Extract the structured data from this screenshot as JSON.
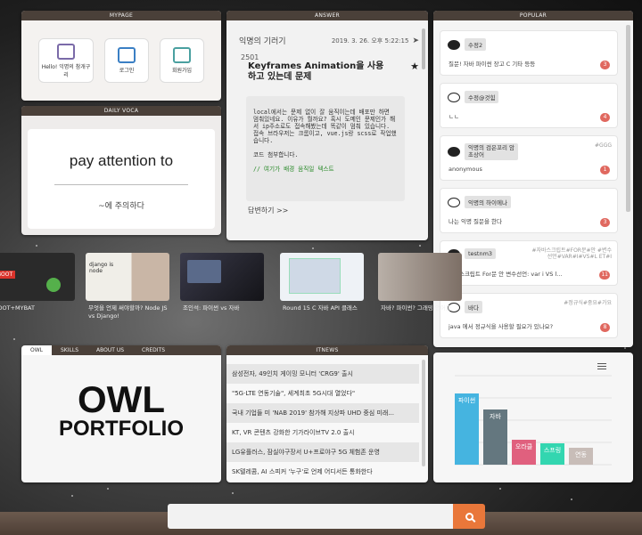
{
  "mypage": {
    "title": "MYPAGE",
    "buttons": [
      {
        "label": "Hello! 익명의 참개구리",
        "icon": "user-profile-icon"
      },
      {
        "label": "로그인",
        "icon": "login-icon"
      },
      {
        "label": "회원가입",
        "icon": "signup-icon"
      }
    ]
  },
  "voca": {
    "title": "DAILY VOCA",
    "word": "pay attention to",
    "meaning": "~에 주의하다"
  },
  "answer": {
    "title": "ANSWER",
    "author": "익명의 기러기",
    "date": "2019. 3. 26. 오후 5:22:15",
    "number": "2501",
    "question_title": "Keyframes Animation을 사용하고 있는데 문제",
    "body_p1": "local에서는 문제 없이 잘 움직이는데 배포만 하면 멈춰있네요. 이유가 뭘까요? 혹시 도메인 문제인가 해서 ip주소로도 접속해봤는데 똑같이 멈춰 있습니다.",
    "body_p2": "접속 브라우저는 크롬이고, vue.js랑 scss로 작업했습니다.",
    "body_p3": "코드 첨부합니다.",
    "code_comment": "// 여기가 배경 움직일 텍스트",
    "reply_label": "답변하기 >>",
    "icons": {
      "share": "share-icon",
      "star": "star-icon"
    }
  },
  "popular": {
    "title": "POPULAR",
    "items": [
      {
        "name": "수정2",
        "tags": "",
        "text": "질문! 자바 파이썬 장고 C 기타 등등",
        "count": "3",
        "filled": true
      },
      {
        "name": "수정@것힘",
        "tags": "",
        "text": "ㄴㄴ",
        "count": "4",
        "filled": false
      },
      {
        "name": "익명의 검은꼬리 암초상어",
        "tags": "#GGG",
        "text": "anonymous",
        "count": "1",
        "filled": true
      },
      {
        "name": "익명의 하이에나",
        "tags": "",
        "text": "나는 익명 질문을 한다",
        "count": "3",
        "filled": false
      },
      {
        "name": "testnm3",
        "tags": "#자바스크립트#FOR문#안 #변수선언#VAR#I#VS#L ET#I",
        "text": "자바스크립트 For문 안 변수선언: var i VS l...",
        "count": "11",
        "filled": true
      },
      {
        "name": "바다",
        "tags": "#정규식#중요#가요",
        "text": "java 에서 정규식을 사용할 필요가 있나요?",
        "count": "8",
        "filled": false
      }
    ]
  },
  "videos": [
    {
      "caption": "BOOT+MYBAT",
      "thumb_text": "BOOT"
    },
    {
      "caption": "무엇을 언제 써야할까? Node JS vs Django!",
      "thumb_text": "django is node"
    },
    {
      "caption": "조인석: 파이썬 vs 자바",
      "thumb_text": ""
    },
    {
      "caption": "Round 15 C 자바 API 클래스",
      "thumb_text": ""
    },
    {
      "caption": "자바? 파이썬? 그래밍 언어를",
      "thumb_text": ""
    }
  ],
  "owl": {
    "tabs": [
      "OWL",
      "SKILLS",
      "ABOUT US",
      "CREDITS"
    ],
    "line1": "OWL",
    "line2": "PORTFOLIO"
  },
  "itnews": {
    "title": "ITNEWS",
    "items": [
      "삼성전자, 49인치 게이밍 모니터 'CRG9' 출시",
      "\"5G·LTE 연동기술\", 세계최초 5G시대 열었다\"",
      "국내 기업들 미 'NAB 2019' 참가해 지상파 UHD 중심 미래...",
      "KT, VR 콘텐츠 강화한 기가라이브TV 2.0 출시",
      "LG유플러스, 잠실야구장서 U+프로야구 5G 체험존 운영",
      "SK텔레콤, AI 스피커 '누구'로 언제 어디서든 통화한다"
    ]
  },
  "chart_data": {
    "type": "bar",
    "categories": [
      "파이썬",
      "자바",
      "오라클",
      "스프링",
      "연동"
    ],
    "values": [
      80,
      62,
      28,
      24,
      19
    ],
    "colors": [
      "#45b4e0",
      "#64777f",
      "#e0607e",
      "#33d6b0",
      "#c8bdb8"
    ],
    "title": "",
    "xlabel": "",
    "ylabel": "",
    "ylim": [
      0,
      100
    ],
    "grid": true
  },
  "search": {
    "placeholder": "",
    "icon": "search-icon"
  }
}
